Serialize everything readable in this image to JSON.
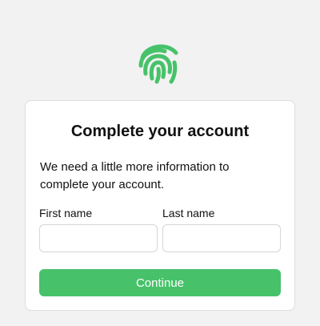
{
  "brand": {
    "logo_icon": "fingerprint-icon",
    "accent_color": "#47c26a"
  },
  "card": {
    "title": "Complete your account",
    "description": "We need a little more information to complete your account."
  },
  "form": {
    "first_name": {
      "label": "First name",
      "value": "",
      "placeholder": ""
    },
    "last_name": {
      "label": "Last name",
      "value": "",
      "placeholder": ""
    },
    "submit_label": "Continue"
  }
}
